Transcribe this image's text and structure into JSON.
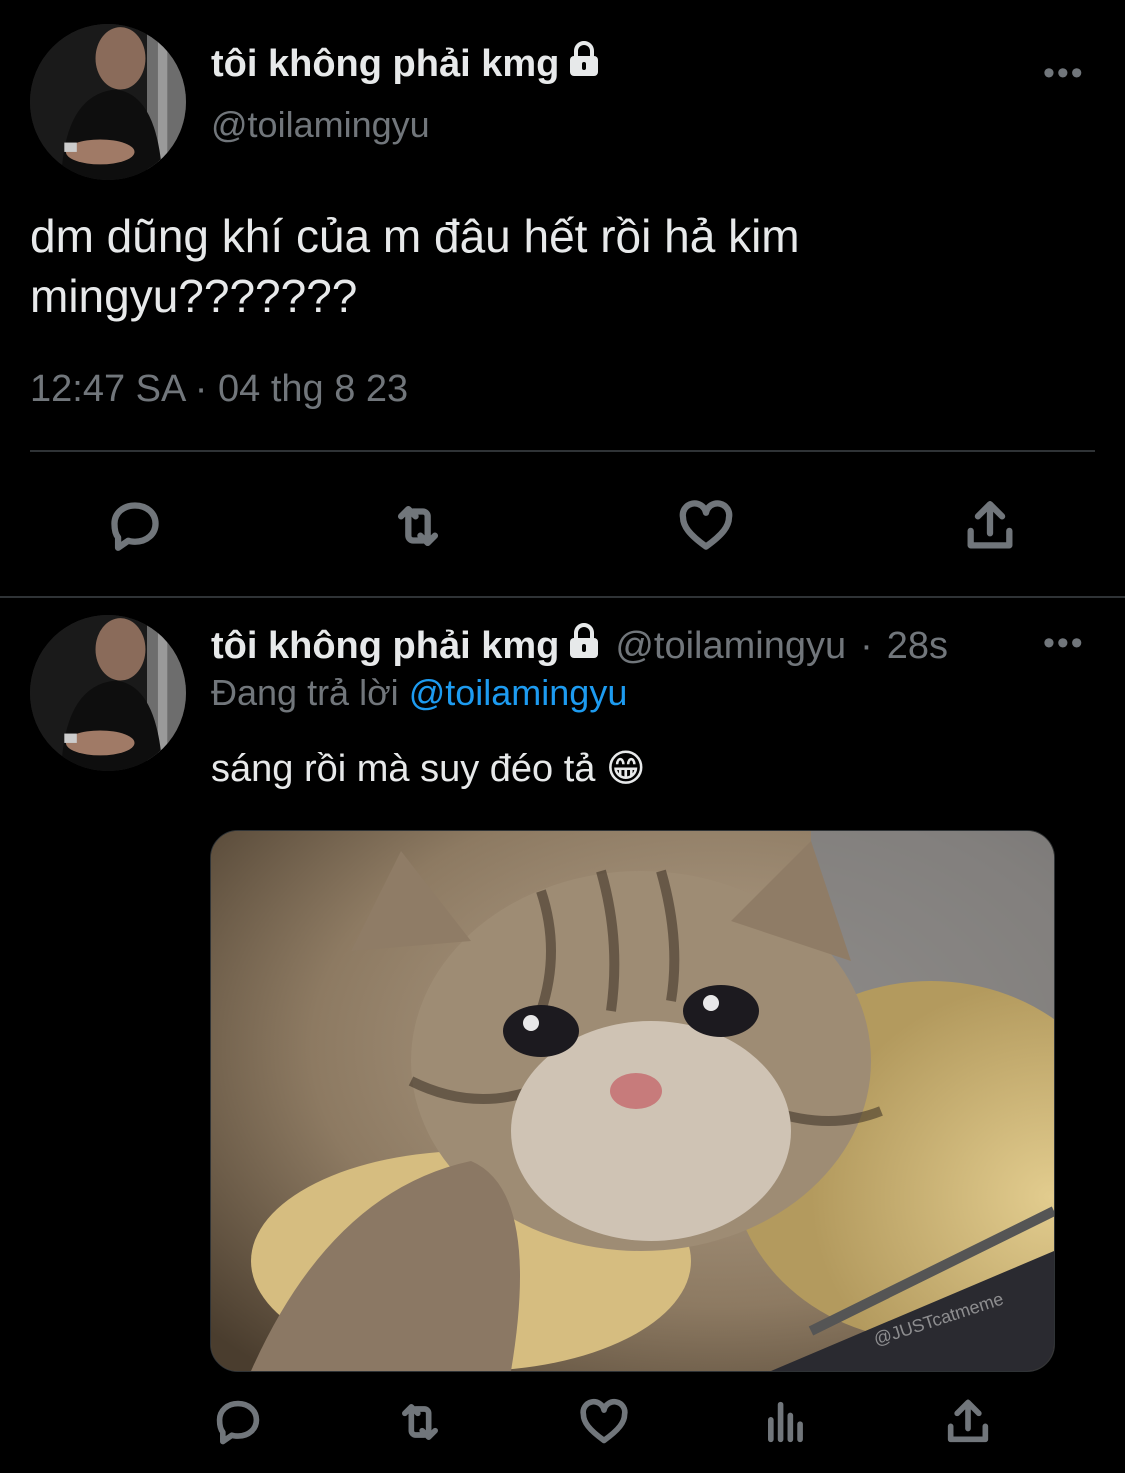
{
  "tweet": {
    "display_name": "tôi không phải kmg",
    "handle": "@toilamingyu",
    "text": "dm dũng khí của m đâu hết rồi hả kim mingyu???????",
    "timestamp": "12:47 SA · 04 thg 8 23",
    "more_label": "•••",
    "icons": [
      "reply-icon",
      "retweet-icon",
      "like-icon",
      "share-icon"
    ]
  },
  "reply": {
    "display_name": "tôi không phải kmg",
    "handle": "@toilamingyu",
    "separator": "·",
    "time": "28s",
    "replying_prefix": "Đang trả lời",
    "replying_to": "@toilamingyu",
    "text": "sáng rồi mà suy đéo tả 😁",
    "more_label": "•••",
    "media_watermark": "@JUSTcatmeme",
    "icons": [
      "reply-icon",
      "retweet-icon",
      "like-icon",
      "analytics-icon",
      "share-icon"
    ]
  },
  "colors": {
    "background": "#000000",
    "text": "#e7e9ea",
    "muted": "#71767b",
    "link": "#1d9bf0",
    "divider": "#2f3336"
  }
}
